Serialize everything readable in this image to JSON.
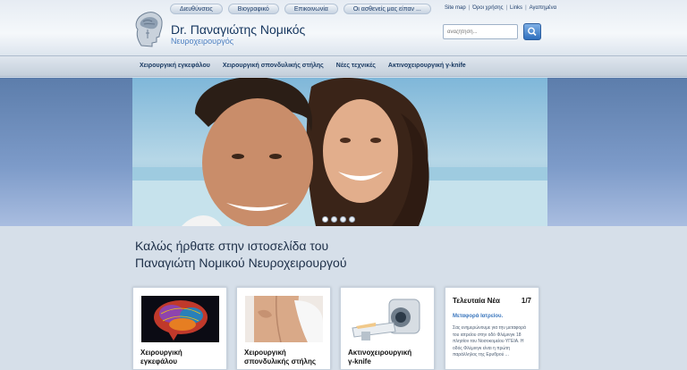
{
  "header": {
    "top_tabs": [
      "Διευθύνσεις",
      "Βιογραφικό",
      "Επικοινωνία",
      "Οι ασθενείς μας είπαν ..."
    ],
    "utility_links": [
      "Site map",
      "Όροι χρήσης",
      "Links",
      "Αγαπημένα"
    ],
    "title": "Dr. Παναγιώτης Νομικός",
    "subtitle": "Νευροχειρουργός",
    "search_placeholder": "αναζήτηση..."
  },
  "nav": {
    "items": [
      "Χειρουργική εγκεφάλου",
      "Χειρουργική σπονδυλικής στήλης",
      "Νέες τεχνικές",
      "Ακτινοχειρουργική γ-knife"
    ]
  },
  "slider": {
    "slide_count": 4,
    "active_index": 0
  },
  "welcome": {
    "line1": "Καλώς ήρθατε στην ιστοσελίδα του",
    "line2": "Παναγιώτη Νομικού Νευροχειρουργού"
  },
  "cards": [
    {
      "title_line1": "Χειρουργική",
      "title_line2": "εγκεφάλου"
    },
    {
      "title_line1": "Χειρουργική",
      "title_line2": "σπονδυλικής στήλης"
    },
    {
      "title_line1": "Ακτινοχειρουργική",
      "title_line2": "γ-knife"
    }
  ],
  "news": {
    "title": "Τελευταία Νέα",
    "counter": "1/7",
    "headline": "Μεταφορά Ιατρείου.",
    "body": "Σας ενημερώνουμε για την μεταφορά του ιατρείου στην οδό Φλέμινγκ 18 πλησίον του Νοσοκομείου ΥΓΕΙΑ. Η οδός Φλέμινγκ είναι η πρώτη παράλληλος της Ερυθρού ..."
  },
  "colors": {
    "brand_dark": "#15365f",
    "brand_light": "#4c7fc1",
    "link": "#3a76bd"
  }
}
